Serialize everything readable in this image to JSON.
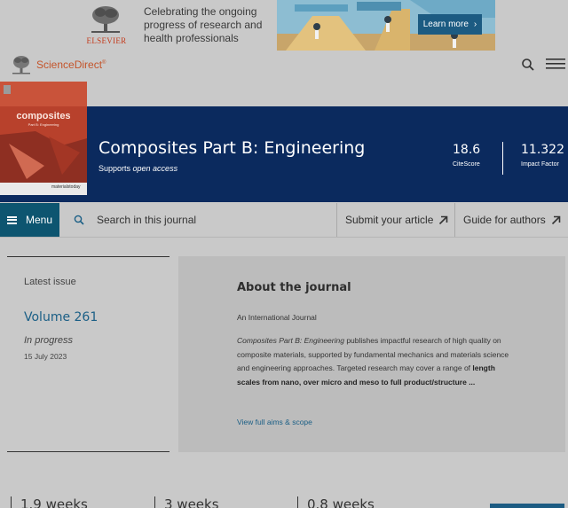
{
  "ad": {
    "logo_text": "ELSEVIER",
    "text": "Celebrating the ongoing progress of research and health professionals",
    "button_label": "Learn more",
    "button_chevron": "›"
  },
  "topnav": {
    "logo_text": "ScienceDirect",
    "logo_mark": "®",
    "icons": [
      "search-icon",
      "hamburger-menu-icon"
    ]
  },
  "journal": {
    "title": "Composites Part B: Engineering",
    "support_prefix": "Supports ",
    "support_emph": "open access",
    "cover": {
      "title": "composites",
      "subtitle": "Part B: Engineering",
      "footer": "materialstoday"
    },
    "metrics": [
      {
        "value": "18.6",
        "label": "CiteScore"
      },
      {
        "value": "11.322",
        "label": "Impact Factor"
      }
    ]
  },
  "jnav": {
    "menu_label": "Menu",
    "search_placeholder": "Search in this journal",
    "submit_label": "Submit your article",
    "guide_label": "Guide for authors"
  },
  "latest": {
    "label": "Latest issue",
    "volume": "Volume 261",
    "status": "In progress",
    "date": "15 July 2023"
  },
  "about": {
    "title": "About the journal",
    "subtitle": "An International Journal",
    "desc_journal": "Composites Part B: Engineering",
    "desc_body": " publishes impactful research of high quality on composite materials, supported by fundamental mechanics and materials science and engineering approaches. Targeted research may cover a range of ",
    "desc_bold": "length scales from nano, over micro and meso to full product/structure ...",
    "link": "View full aims & scope"
  },
  "stats": [
    "1.9 weeks",
    "3 weeks",
    "0.8 weeks"
  ],
  "colors": {
    "header_bg": "#0b2a5e",
    "accent": "#1b5f86",
    "menu_bg": "#0d5570",
    "brand": "#c4542a"
  }
}
